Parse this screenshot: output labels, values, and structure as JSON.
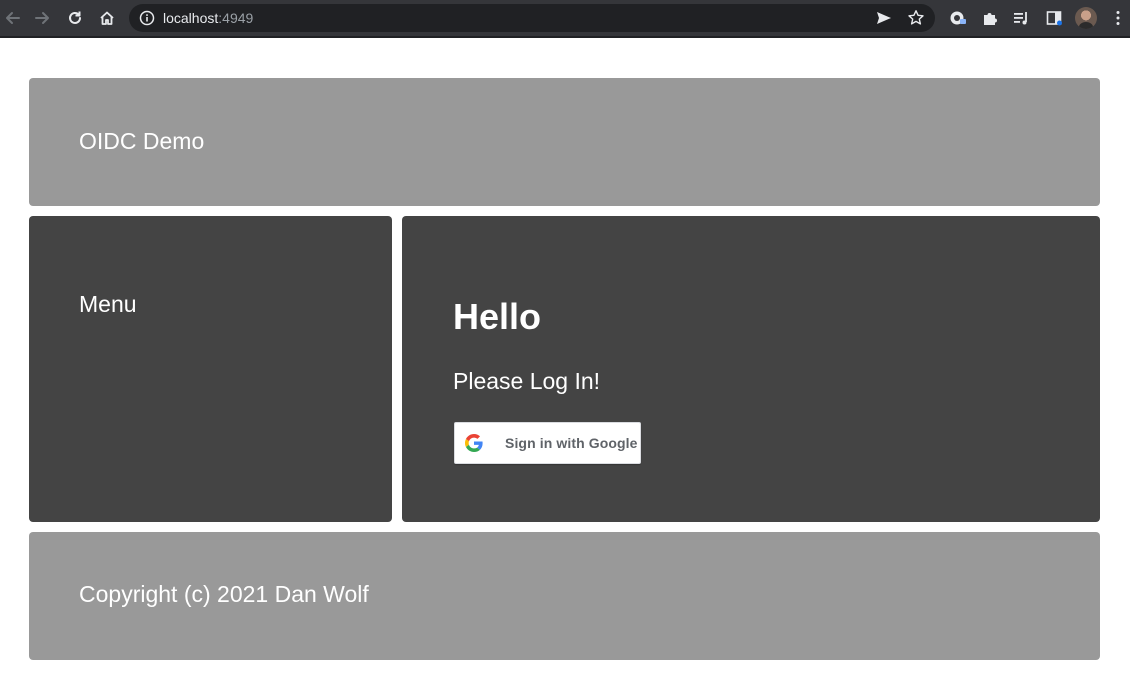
{
  "browser": {
    "url_host": "localhost",
    "url_port": ":4949",
    "icons": [
      "back-icon",
      "forward-icon",
      "reload-icon",
      "home-icon",
      "info-icon",
      "send-icon",
      "star-icon",
      "password-key-icon",
      "extensions-icon",
      "reading-list-icon",
      "side-panel-icon",
      "avatar",
      "more-icon"
    ]
  },
  "header": {
    "title": "OIDC Demo"
  },
  "sidebar": {
    "title": "Menu"
  },
  "main": {
    "heading": "Hello",
    "subheading": "Please Log In!",
    "google_button_label": "Sign in with Google"
  },
  "footer": {
    "text": "Copyright (c) 2021 Dan Wolf"
  },
  "colors": {
    "header_bg": "#999999",
    "panel_bg": "#444444",
    "text": "#ffffff",
    "browser_toolbar": "#35363a"
  }
}
